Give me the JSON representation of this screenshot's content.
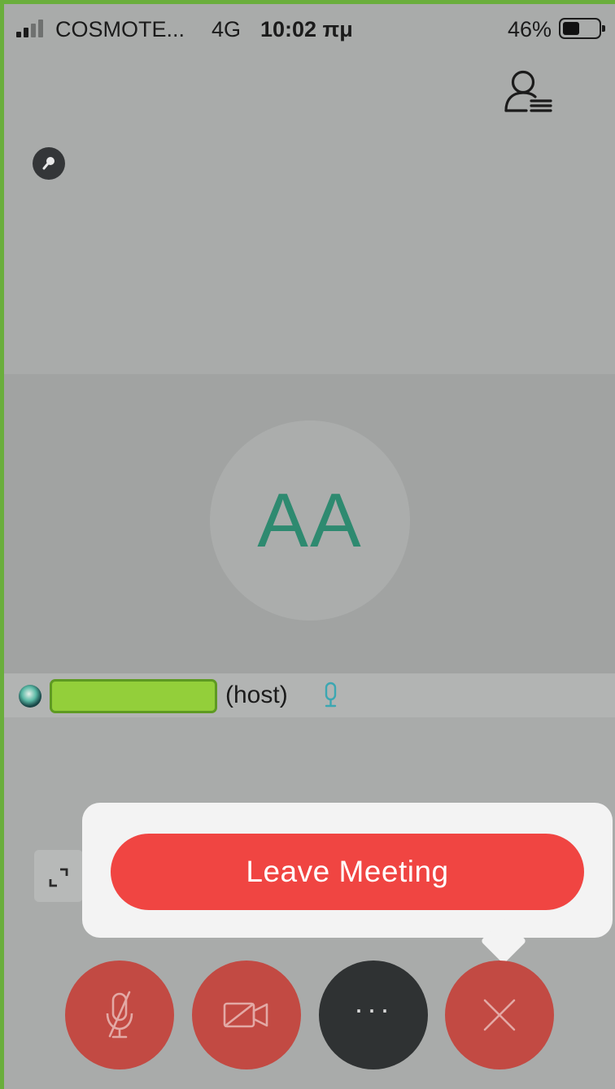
{
  "status_bar": {
    "carrier": "COSMOTE...",
    "network": "4G",
    "time": "10:02 πμ",
    "battery_percent": "46%",
    "battery_level": 0.46,
    "signal_bars_active": 2,
    "signal_bars_total": 4
  },
  "meeting": {
    "avatar_initials": "AA",
    "participant_role": "(host)"
  },
  "popover": {
    "leave_label": "Leave Meeting"
  },
  "controls": {
    "more_glyph": "···"
  },
  "colors": {
    "leave_red": "#f04542",
    "control_red": "#c24a43",
    "control_dark": "#2f3233",
    "avatar_text": "#2e8a70",
    "redaction_green": "#93cf3a",
    "mic_accent": "#3ba7b2"
  },
  "icons": {
    "participants": "participants-list-icon",
    "lock": "lock-badge-icon",
    "expand": "expand-icon",
    "mic_off": "mic-muted-icon",
    "video_off": "video-off-icon",
    "more": "more-icon",
    "end": "close-icon"
  }
}
